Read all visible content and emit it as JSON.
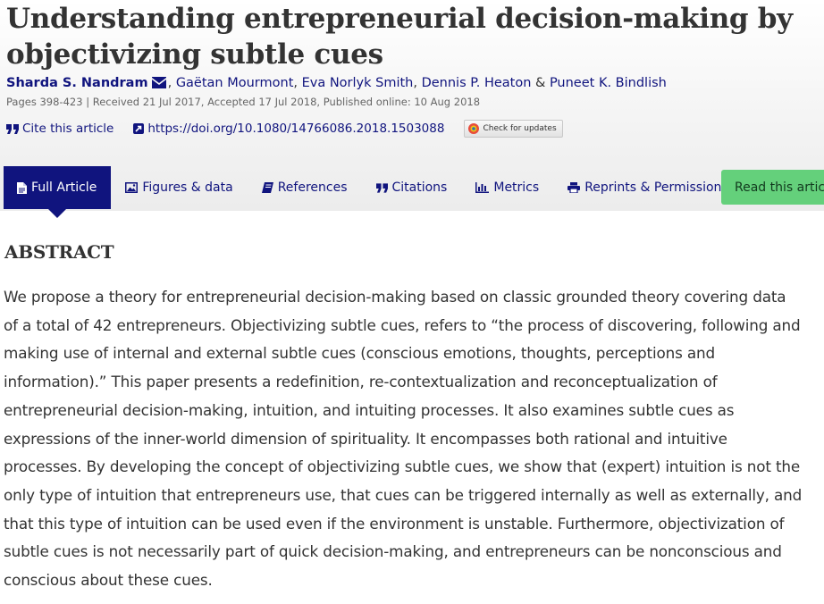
{
  "article": {
    "title": "Understanding entrepreneurial decision-making by objectivizing subtle cues",
    "authors": [
      "Sharda S. Nandram",
      "Gaëtan Mourmont",
      "Eva Norlyk Smith",
      "Dennis P. Heaton",
      "Puneet K. Bindlish"
    ],
    "author_separator_comma": ",",
    "author_separator_and": "&",
    "pub_info": "Pages 398-423 | Received 21 Jul 2017, Accepted 17 Jul 2018, Published online: 10 Aug 2018"
  },
  "links": {
    "cite": "Cite this article",
    "doi": "https://doi.org/10.1080/14766086.2018.1503088",
    "check_updates": "Check for updates"
  },
  "tabs": [
    {
      "label": "Full Article",
      "icon": "document-icon",
      "active": true
    },
    {
      "label": "Figures & data",
      "icon": "image-icon",
      "active": false
    },
    {
      "label": "References",
      "icon": "book-icon",
      "active": false
    },
    {
      "label": "Citations",
      "icon": "quote-icon",
      "active": false
    },
    {
      "label": "Metrics",
      "icon": "bar-chart-icon",
      "active": false
    },
    {
      "label": "Reprints & Permissions",
      "icon": "print-icon",
      "active": false
    }
  ],
  "read_button": "Read this article",
  "abstract": {
    "heading": "ABSTRACT",
    "lines": [
      "We propose a theory for entrepreneurial decision-making based on classic grounded theory covering data",
      "of a total of 42 entrepreneurs. Objectivizing subtle cues, refers to “the process of discovering, following and",
      "making use of internal and external subtle cues (conscious emotions, thoughts, perceptions and",
      "information).” This paper presents a redefinition, re-contextualization and reconceptualization of",
      "entrepreneurial decision-making, intuition, and intuiting processes. It also examines subtle cues as",
      "expressions of the inner-world dimension of spirituality. It encompasses both rational and intuitive",
      "processes. By developing the concept of objectivizing subtle cues, we show that (expert) intuition is not the",
      "only type of intuition that entrepreneurs use, that cues can be triggered internally as well as externally, and",
      "that this type of intuition can be used even if the environment is unstable. Furthermore, objectivization of",
      "subtle cues is not necessarily part of quick decision-making, and entrepreneurs can be nonconscious and",
      "conscious about these cues."
    ]
  },
  "colors": {
    "brand_navy": "#10147e",
    "read_button_green": "#64d07b",
    "text": "#333333",
    "meta_text": "#666666"
  }
}
